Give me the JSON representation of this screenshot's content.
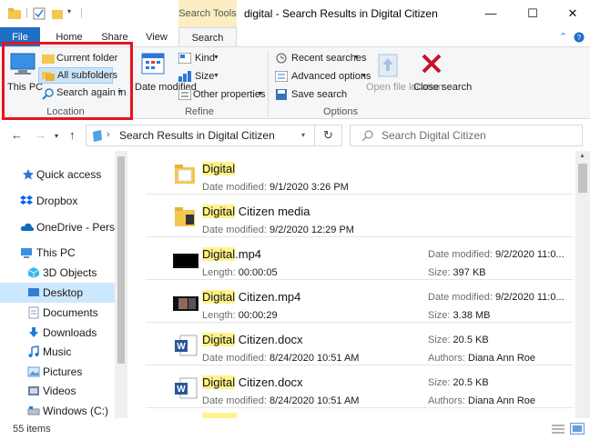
{
  "window": {
    "title": "digital - Search Results in Digital Citizen",
    "context_tab": "Search Tools",
    "controls": [
      "—",
      "☐",
      "✕"
    ]
  },
  "tabs": [
    "File",
    "Home",
    "Share",
    "View",
    "Search"
  ],
  "ribbon": {
    "location": {
      "this_pc": "This PC",
      "current_folder": "Current folder",
      "all_subfolders": "All subfolders",
      "search_again_in": "Search again in",
      "label": "Location"
    },
    "refine": {
      "date_modified": "Date modified",
      "kind": "Kind",
      "size": "Size",
      "other_properties": "Other properties",
      "label": "Refine"
    },
    "options": {
      "recent_searches": "Recent searches",
      "advanced_options": "Advanced options",
      "save_search": "Save search",
      "open_file_location": "Open file location",
      "close_search": "Close search",
      "label": "Options"
    }
  },
  "address": {
    "path": "Search Results in Digital Citizen",
    "search_placeholder": "Search Digital Citizen"
  },
  "nav": [
    {
      "label": "Quick access",
      "icon": "star-icon",
      "color": "#2b78d6"
    },
    {
      "label": "Dropbox",
      "icon": "dropbox-icon",
      "color": "#0061fe"
    },
    {
      "label": "OneDrive - Person",
      "icon": "cloud-icon",
      "color": "#0f6cbd"
    },
    {
      "label": "This PC",
      "icon": "computer-icon",
      "color": "#3a8ee6"
    },
    {
      "label": "3D Objects",
      "icon": "cube-icon",
      "color": "#35b8e8"
    },
    {
      "label": "Desktop",
      "icon": "desktop-icon",
      "color": "#2f7fd6"
    },
    {
      "label": "Documents",
      "icon": "document-icon",
      "color": "#8a9bb0"
    },
    {
      "label": "Downloads",
      "icon": "download-icon",
      "color": "#1c7ed6"
    },
    {
      "label": "Music",
      "icon": "music-icon",
      "color": "#2b78d6"
    },
    {
      "label": "Pictures",
      "icon": "pictures-icon",
      "color": "#5b9bd5"
    },
    {
      "label": "Videos",
      "icon": "video-icon",
      "color": "#6b7fa0"
    },
    {
      "label": "Windows (C:)",
      "icon": "drive-icon",
      "color": "#7a8899"
    }
  ],
  "results": [
    {
      "hl": "Digital",
      "rest": "",
      "type": "folder",
      "meta_label": "Date modified:",
      "meta_value": "9/1/2020 3:26 PM",
      "r1_label": "",
      "r1_value": "",
      "r2_label": "",
      "r2_value": ""
    },
    {
      "hl": "Digital",
      "rest": " Citizen media",
      "type": "folder-media",
      "meta_label": "Date modified:",
      "meta_value": "9/2/2020 12:29 PM",
      "r1_label": "",
      "r1_value": "",
      "r2_label": "",
      "r2_value": ""
    },
    {
      "hl": "Digital",
      "rest": ".mp4",
      "type": "video",
      "meta_label": "Length:",
      "meta_value": "00:00:05",
      "r1_label": "Date modified:",
      "r1_value": "9/2/2020 11:0...",
      "r2_label": "Size:",
      "r2_value": "397 KB"
    },
    {
      "hl": "Digital",
      "rest": " Citizen.mp4",
      "type": "video2",
      "meta_label": "Length:",
      "meta_value": "00:00:29",
      "r1_label": "Date modified:",
      "r1_value": "9/2/2020 11:0...",
      "r2_label": "Size:",
      "r2_value": "3.38 MB"
    },
    {
      "hl": "Digital",
      "rest": " Citizen.docx",
      "type": "word",
      "meta_label": "Date modified:",
      "meta_value": "8/24/2020 10:51 AM",
      "r1_label": "Size:",
      "r1_value": "20.5 KB",
      "r2_label": "Authors:",
      "r2_value": "Diana Ann Roe"
    },
    {
      "hl": "Digital",
      "rest": " Citizen.docx",
      "type": "word",
      "meta_label": "Date modified:",
      "meta_value": "8/24/2020 10:51 AM",
      "r1_label": "Size:",
      "r1_value": "20.5 KB",
      "r2_label": "Authors:",
      "r2_value": "Diana Ann Roe"
    }
  ],
  "status": {
    "items": "55 items"
  },
  "colors": {
    "accent": "#1f6fc5",
    "highlight": "#fff38a",
    "callout": "#e8141c",
    "context_tab": "#fbeec3"
  }
}
